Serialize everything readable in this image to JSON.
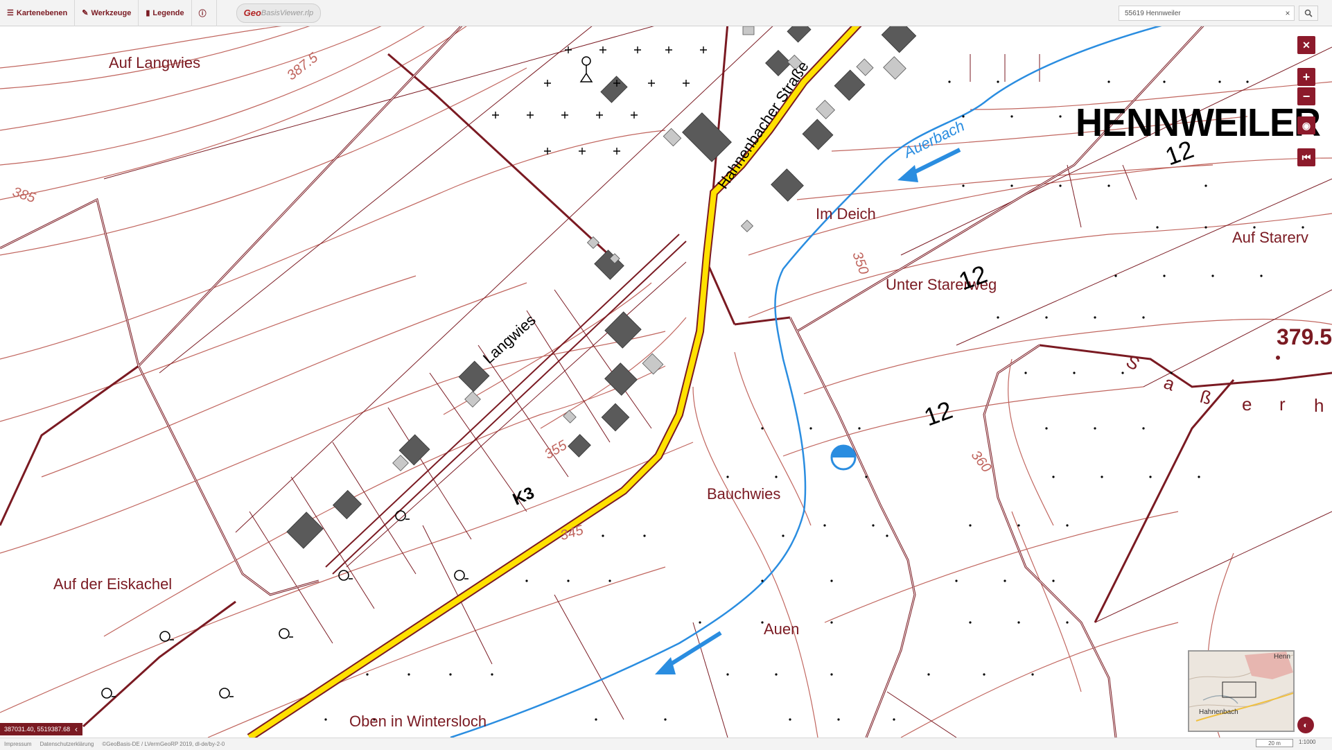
{
  "toolbar": {
    "layers_label": "Kartenebenen",
    "tools_label": "Werkzeuge",
    "legend_label": "Legende",
    "info_icon": "info-icon",
    "logo_geo": "Geo",
    "logo_rest": "BasisViewer.rlp"
  },
  "search": {
    "value": "55619 Hennweiler",
    "clear_glyph": "×",
    "button_icon": "search-icon"
  },
  "map_labels": {
    "place_hennweiler": "HENNWEILER",
    "auf_langwies": "Auf Langwies",
    "langwies": "Langwies",
    "hahnenbacher": "Hahnenbacher Straße",
    "auerbach": "Auerbach",
    "im_deich": "Im Deich",
    "unter_starerweg": "Unter Starerweg",
    "auf_starer": "Auf Starerv",
    "bauchwies": "Bauchwies",
    "auf_der_eiskachel": "Auf der Eiskachel",
    "auen": "Auen",
    "oben_in_wintersloch": "Oben in Wintersloch",
    "road_k3": "K3",
    "spot_height": "379.5",
    "strasse_letters": [
      "S",
      "a",
      "ß",
      "e",
      "r",
      "h"
    ],
    "contour_387": "387.5",
    "contour_385": "385",
    "contour_355": "355",
    "contour_350": "350",
    "contour_345": "345",
    "contour_360": "360",
    "house_12a": "12",
    "house_12b": "12",
    "house_12c": "12"
  },
  "controls": {
    "close_glyph": "✕",
    "zoom_in_glyph": "+",
    "zoom_out_glyph": "−",
    "locate_glyph": "◉",
    "home_glyph": "⏮"
  },
  "overview": {
    "label_henn": "Henn",
    "label_hahnenbach": "Hahnenbach"
  },
  "coordinates": "387031.40, 5519387.68",
  "footer": {
    "impressum": "Impressum",
    "datenschutz": "Datenschutzerklärung",
    "copyright": "©GeoBasis-DE / LVermGeoRP 2019, dl-de/by-2-0"
  },
  "scale": {
    "bar_label": "20 m",
    "ratio": "1:1000"
  },
  "colors": {
    "parcel": "#7a1a22",
    "contour": "#c0655e",
    "road": "#ffe100",
    "water": "#2a8de0"
  }
}
